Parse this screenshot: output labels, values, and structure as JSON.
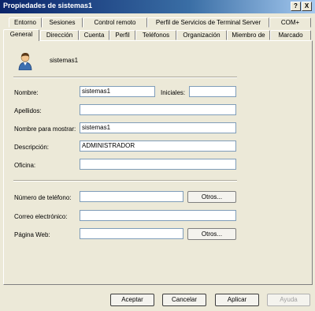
{
  "window": {
    "title": "Propiedades de sistemas1"
  },
  "titlebar_buttons": {
    "help": "?",
    "close": "X"
  },
  "tabs_back_row": [
    "Entorno",
    "Sesiones",
    "Control remoto",
    "Perfil de Servicios de Terminal Server",
    "COM+"
  ],
  "tabs_front_row": [
    "General",
    "Dirección",
    "Cuenta",
    "Perfil",
    "Teléfonos",
    "Organización",
    "Miembro de",
    "Marcado"
  ],
  "active_tab": "General",
  "account": {
    "name": "sistemas1",
    "icon": "user-icon"
  },
  "form": {
    "nombre_label": "Nombre:",
    "nombre_value": "sistemas1",
    "iniciales_label": "Iniciales:",
    "iniciales_value": "",
    "apellidos_label": "Apellidos:",
    "apellidos_value": "",
    "nombre_mostrar_label": "Nombre para mostrar:",
    "nombre_mostrar_value": "sistemas1",
    "descripcion_label": "Descripción:",
    "descripcion_value": "ADMINISTRADOR",
    "oficina_label": "Oficina:",
    "oficina_value": "",
    "telefono_label": "Número de teléfono:",
    "telefono_value": "",
    "telefono_otros": "Otros...",
    "correo_label": "Correo electrónico:",
    "correo_value": "",
    "web_label": "Página Web:",
    "web_value": "",
    "web_otros": "Otros..."
  },
  "buttons": {
    "ok": "Aceptar",
    "cancel": "Cancelar",
    "apply": "Aplicar",
    "help": "Ayuda"
  }
}
